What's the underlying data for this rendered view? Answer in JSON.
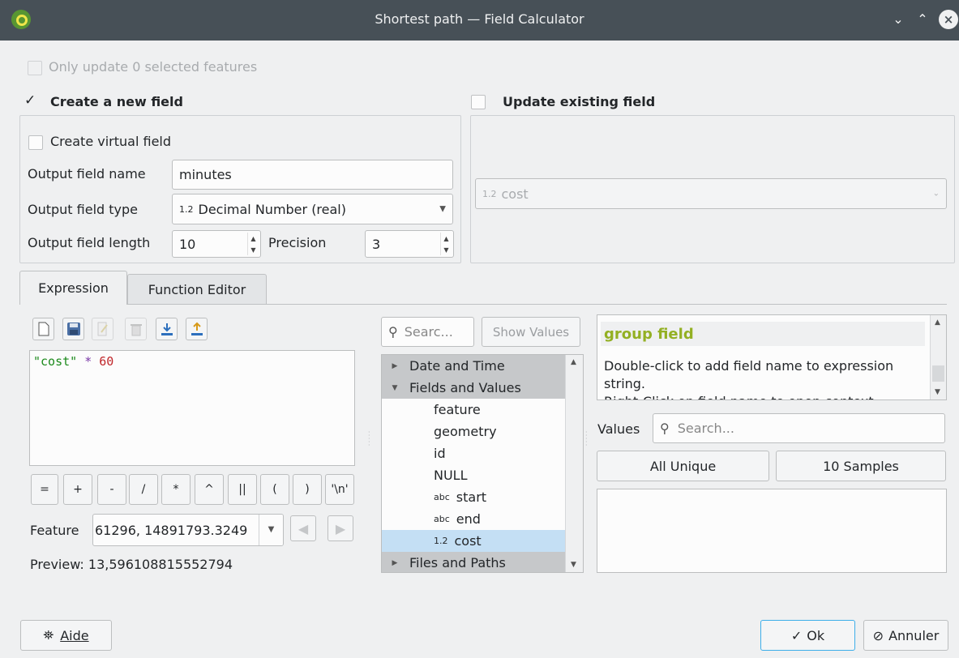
{
  "window": {
    "title": "Shortest path — Field Calculator"
  },
  "top": {
    "only_update_label": "Only update 0 selected features",
    "create_new_field_label": "Create a new field",
    "update_existing_label": "Update existing field"
  },
  "new_field": {
    "virtual_label": "Create virtual field",
    "name_label": "Output field name",
    "name_value": "minutes",
    "type_label": "Output field type",
    "type_tag": "1.2",
    "type_value": "Decimal Number (real)",
    "length_label": "Output field length",
    "length_value": "10",
    "precision_label": "Precision",
    "precision_value": "3"
  },
  "existing_field": {
    "tag": "1.2",
    "value": "cost"
  },
  "tabs": [
    "Expression",
    "Function Editor"
  ],
  "expression": {
    "tok_field": "\"cost\"",
    "tok_op": "*",
    "tok_num": "60",
    "operators": [
      "=",
      "+",
      "-",
      "/",
      "*",
      "^",
      "||",
      "(",
      ")",
      "'\\n'"
    ],
    "feature_label": "Feature",
    "feature_value": "61296, 14891793.3249",
    "preview": "Preview:  13,596108815552794"
  },
  "functions": {
    "search_placeholder": "Searc...",
    "show_values": "Show Values",
    "tree": [
      {
        "label": "Date and Time",
        "tag": ""
      },
      {
        "label": "Fields and Values",
        "tag": ""
      },
      {
        "label": "feature",
        "tag": ""
      },
      {
        "label": "geometry",
        "tag": ""
      },
      {
        "label": "id",
        "tag": ""
      },
      {
        "label": "NULL",
        "tag": ""
      },
      {
        "label": "start",
        "tag": "abc"
      },
      {
        "label": "end",
        "tag": "abc"
      },
      {
        "label": "cost",
        "tag": "1.2"
      },
      {
        "label": "Files and Paths",
        "tag": ""
      }
    ]
  },
  "help": {
    "title": "group field",
    "line1": "Double-click to add field name to expression",
    "line2": "string.",
    "line3": "Right-Click on field name to open context"
  },
  "values": {
    "label": "Values",
    "search_placeholder": "Search...",
    "all_unique": "All Unique",
    "samples": "10 Samples"
  },
  "footer": {
    "help": "Aide",
    "ok": "Ok",
    "cancel": "Annuler"
  }
}
